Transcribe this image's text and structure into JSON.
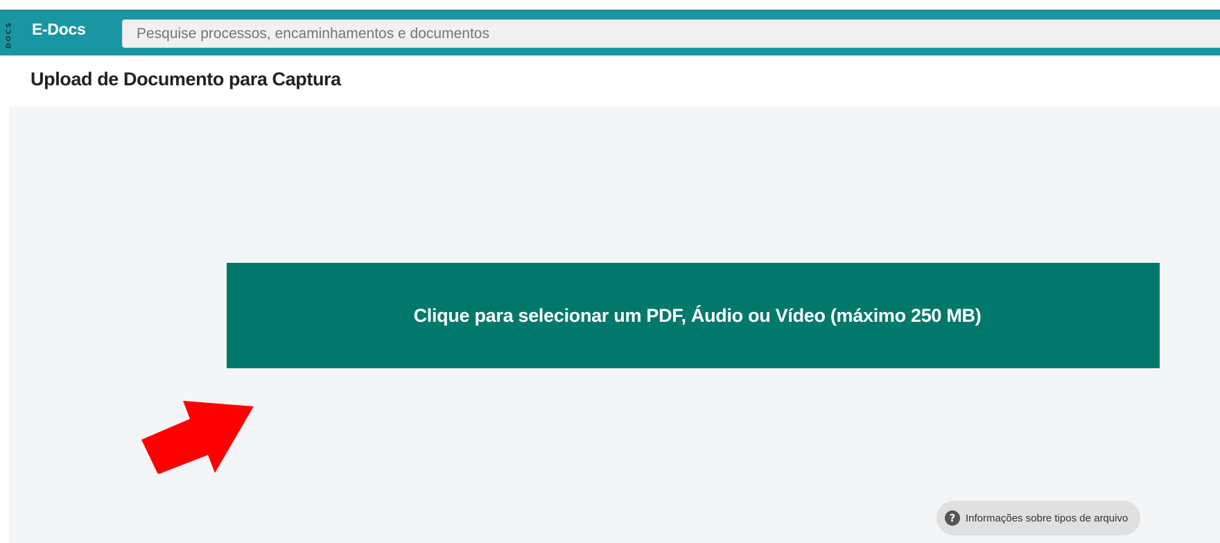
{
  "header": {
    "side_label": "DOCS",
    "app_name": "E-Docs",
    "search_placeholder": "Pesquise processos, encaminhamentos e documentos",
    "color": "#1a96a3"
  },
  "page": {
    "title": "Upload de Documento para Captura"
  },
  "upload": {
    "button_label": "Clique para selecionar um PDF, Áudio ou Vídeo (máximo 250 MB)",
    "button_color": "#00796b",
    "area_color": "#f4f5f7"
  },
  "annotation": {
    "arrow_icon": "red-arrow-icon",
    "arrow_color": "#ff0000"
  },
  "info": {
    "icon": "question-circle-icon",
    "label": "Informações sobre tipos de arquivo"
  }
}
